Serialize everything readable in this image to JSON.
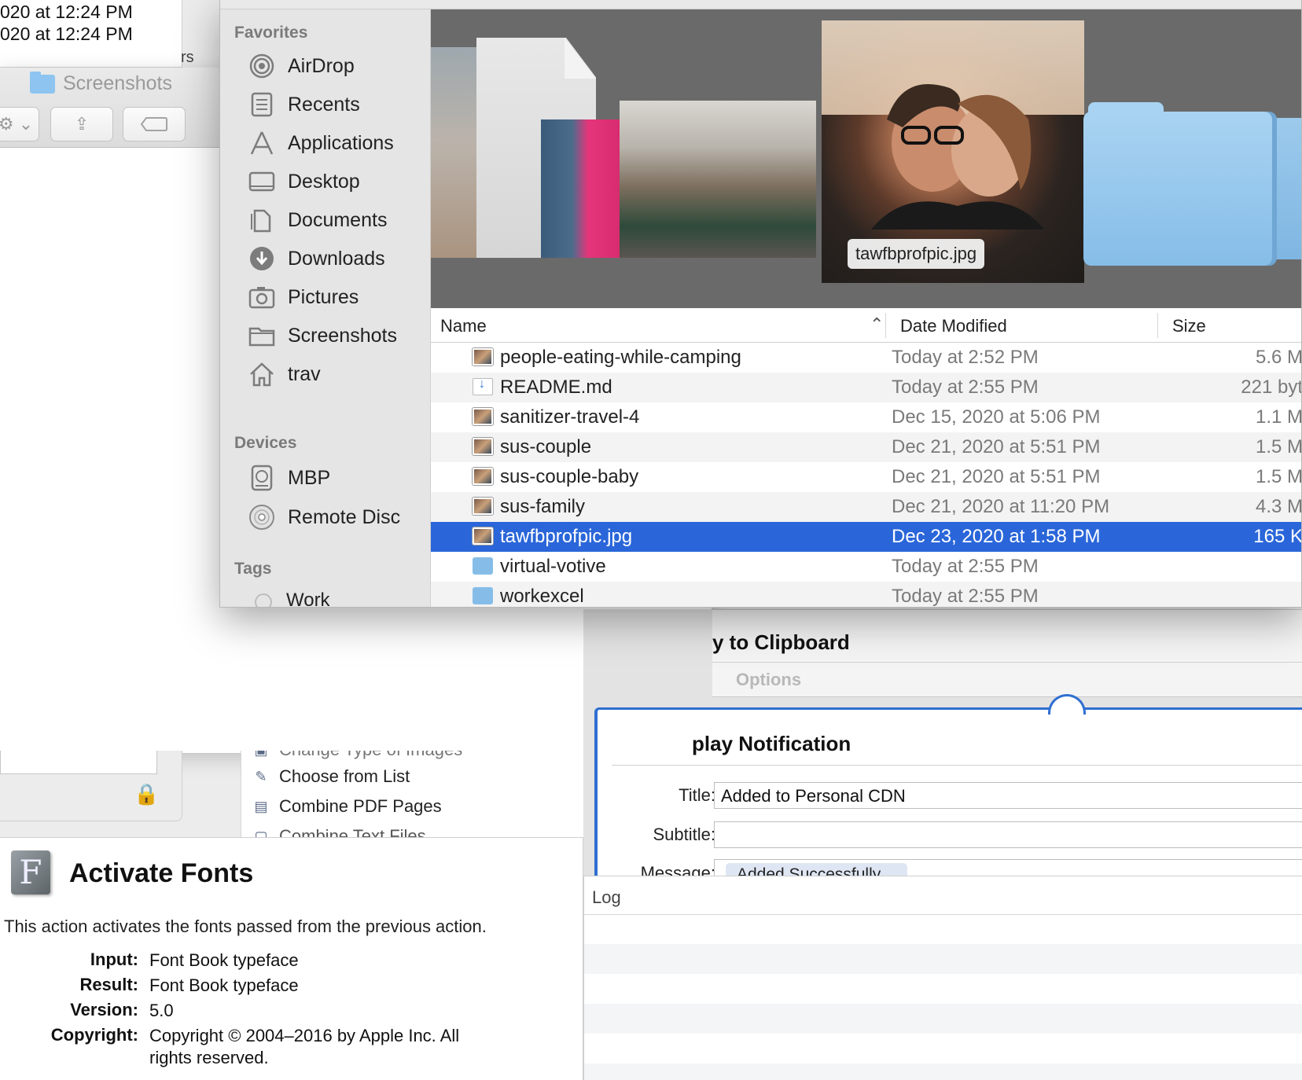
{
  "background": {
    "timestamps": [
      "020 at 12:24 PM",
      "020 at 12:24 PM"
    ],
    "fragment_rs": "rs",
    "finder_title": "Screenshots",
    "actions": [
      {
        "label": "Change Type of Images",
        "icon": "image-icon"
      },
      {
        "label": "Choose from List",
        "icon": "list-icon"
      },
      {
        "label": "Combine PDF Pages",
        "icon": "pdf-icon"
      },
      {
        "label": "Combine Text Files",
        "icon": "text-file-icon"
      }
    ],
    "workflow": {
      "card1_title": "y to Clipboard",
      "card1_options": "Options",
      "card2_title": "play Notification",
      "title_label": "Title:",
      "title_value": "Added to Personal CDN",
      "subtitle_label": "Subtitle:",
      "subtitle_value": "",
      "message_label": "Message:",
      "message_token": "Added Successfully ⌄"
    },
    "log_label": "Log",
    "description": {
      "title": "Activate Fonts",
      "text": "This action activates the fonts passed from the previous action.",
      "input_key": "Input:",
      "input_val": "Font Book typeface",
      "result_key": "Result:",
      "result_val": "Font Book typeface",
      "version_key": "Version:",
      "version_val": "5.0",
      "copyright_key": "Copyright:",
      "copyright_val": "Copyright © 2004–2016 by Apple Inc. All rights reserved."
    }
  },
  "sidebar": {
    "favorites_heading": "Favorites",
    "favorites": [
      {
        "label": "AirDrop",
        "icon": "airdrop-icon"
      },
      {
        "label": "Recents",
        "icon": "recents-icon"
      },
      {
        "label": "Applications",
        "icon": "applications-icon"
      },
      {
        "label": "Desktop",
        "icon": "desktop-icon"
      },
      {
        "label": "Documents",
        "icon": "documents-icon"
      },
      {
        "label": "Downloads",
        "icon": "downloads-icon"
      },
      {
        "label": "Pictures",
        "icon": "pictures-icon"
      },
      {
        "label": "Screenshots",
        "icon": "folder-icon"
      },
      {
        "label": "trav",
        "icon": "home-icon"
      }
    ],
    "devices_heading": "Devices",
    "devices": [
      {
        "label": "MBP",
        "icon": "hard-drive-icon"
      },
      {
        "label": "Remote Disc",
        "icon": "disc-icon"
      }
    ],
    "tags_heading": "Tags",
    "tags": [
      {
        "label": "Work"
      }
    ]
  },
  "coverflow": {
    "caption": "tawfbprofpic.jpg"
  },
  "list": {
    "columns": {
      "name": "Name",
      "date": "Date Modified",
      "size": "Size"
    },
    "sort_indicator": "⌃",
    "rows": [
      {
        "name": "people-eating-while-camping",
        "date": "Today at 2:52 PM",
        "size": "5.6 M",
        "kind": "img",
        "selected": false
      },
      {
        "name": "README.md",
        "date": "Today at 2:55 PM",
        "size": "221 byt",
        "kind": "doc",
        "selected": false
      },
      {
        "name": "sanitizer-travel-4",
        "date": "Dec 15, 2020 at 5:06 PM",
        "size": "1.1 M",
        "kind": "img",
        "selected": false
      },
      {
        "name": "sus-couple",
        "date": "Dec 21, 2020 at 5:51 PM",
        "size": "1.5 M",
        "kind": "img",
        "selected": false
      },
      {
        "name": "sus-couple-baby",
        "date": "Dec 21, 2020 at 5:51 PM",
        "size": "1.5 M",
        "kind": "img",
        "selected": false
      },
      {
        "name": "sus-family",
        "date": "Dec 21, 2020 at 11:20 PM",
        "size": "4.3 M",
        "kind": "img",
        "selected": false
      },
      {
        "name": "tawfbprofpic.jpg",
        "date": "Dec 23, 2020 at 1:58 PM",
        "size": "165 K",
        "kind": "img",
        "selected": true
      },
      {
        "name": "virtual-votive",
        "date": "Today at 2:55 PM",
        "size": "",
        "kind": "folder",
        "selected": false
      },
      {
        "name": "workexcel",
        "date": "Today at 2:55 PM",
        "size": "",
        "kind": "folder",
        "selected": false
      }
    ]
  },
  "colors": {
    "selection": "#2a66d9",
    "accent": "#2f6fd1",
    "folder": "#86bde8"
  }
}
